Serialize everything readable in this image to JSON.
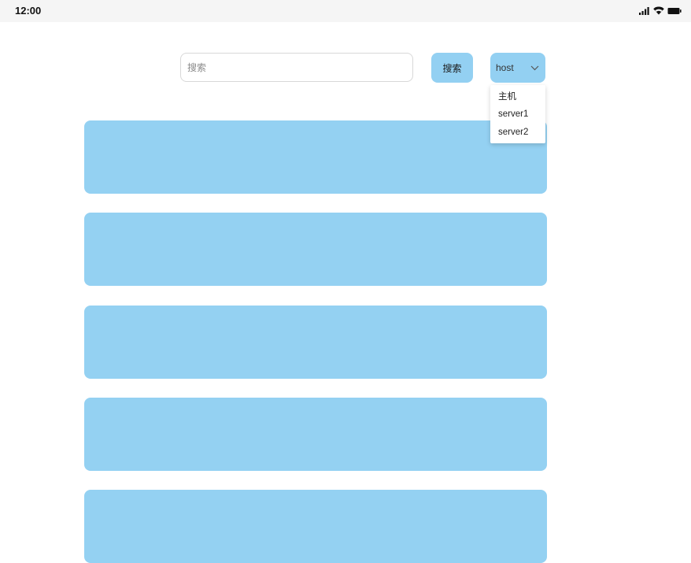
{
  "status_bar": {
    "time": "12:00",
    "icons": [
      "signal-icon",
      "wifi-icon",
      "battery-icon"
    ]
  },
  "search": {
    "placeholder": "搜索",
    "value": "",
    "button_label": "搜索"
  },
  "host_select": {
    "selected": "host",
    "options": [
      "主机",
      "server1",
      "server2"
    ]
  },
  "cards": [
    {
      "color": "#94d1f2"
    },
    {
      "color": "#94d1f2"
    },
    {
      "color": "#94d1f2"
    },
    {
      "color": "#94d1f2"
    },
    {
      "color": "#94d1f2"
    }
  ],
  "colors": {
    "accent": "#93d0f2",
    "status_bar_bg": "#f5f5f5"
  }
}
